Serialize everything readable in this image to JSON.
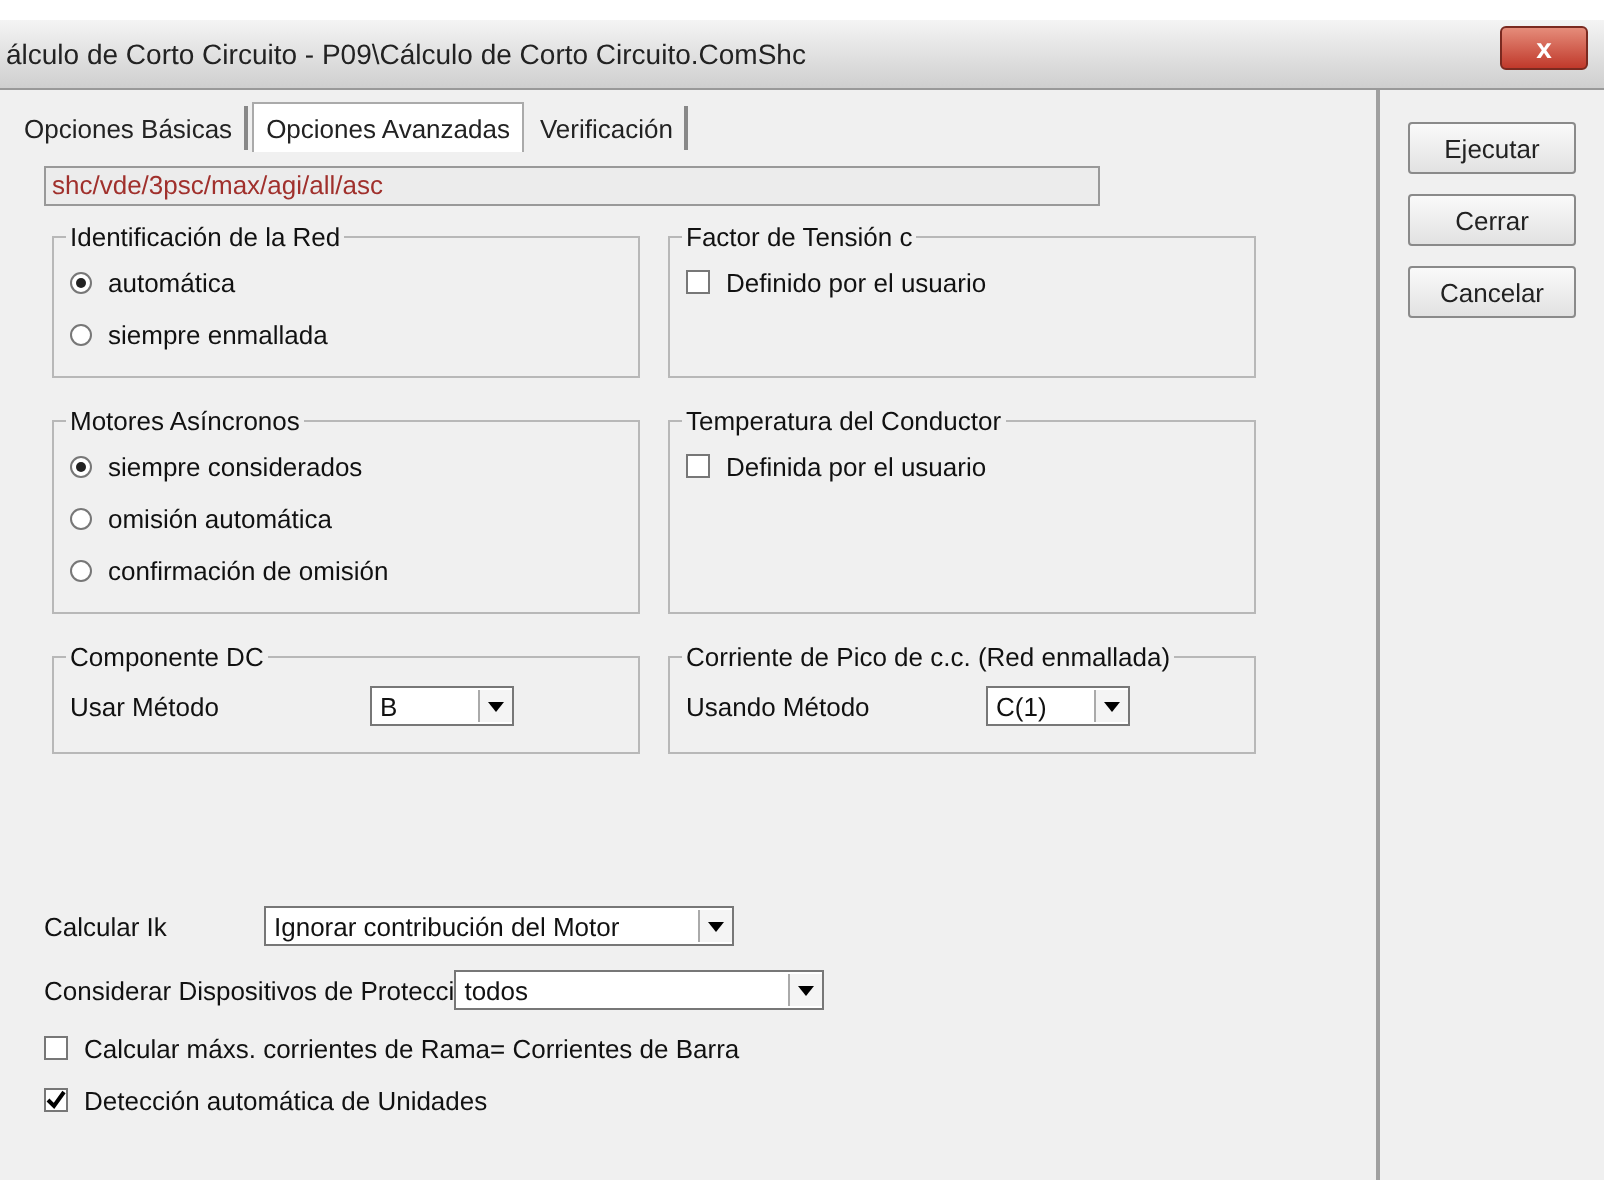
{
  "window": {
    "title": "álculo de Corto Circuito - P09\\Cálculo de Corto Circuito.ComShc",
    "close": "x"
  },
  "tabs": [
    {
      "label": "Opciones Básicas",
      "selected": false
    },
    {
      "label": "Opciones Avanzadas",
      "selected": true
    },
    {
      "label": "Verificación",
      "selected": false
    }
  ],
  "command": "shc/vde/3psc/max/agi/all/asc",
  "groups": [
    {
      "kind": "radio",
      "title": "Identificación de la Red",
      "items": [
        {
          "label": "automática",
          "selected": true
        },
        {
          "label": "siempre enmallada",
          "selected": false
        }
      ]
    },
    {
      "kind": "check",
      "title": "Factor de Tensión c",
      "items": [
        {
          "label": "Definido por el usuario",
          "checked": false
        }
      ]
    },
    {
      "kind": "radio",
      "title": "Motores Asíncronos",
      "items": [
        {
          "label": "siempre considerados",
          "selected": true
        },
        {
          "label": "omisión automática",
          "selected": false
        },
        {
          "label": "confirmación de omisión",
          "selected": false
        }
      ]
    },
    {
      "kind": "check",
      "title": "Temperatura del Conductor",
      "items": [
        {
          "label": "Definida por el usuario",
          "checked": false
        }
      ]
    },
    {
      "kind": "select",
      "title": "Componente DC",
      "label": "Usar Método",
      "value": "B"
    },
    {
      "kind": "select",
      "title": "Corriente de Pico de c.c. (Red enmallada)",
      "label": "Usando Método",
      "value": "C(1)"
    }
  ],
  "fields": [
    {
      "label": "Calcular Ik",
      "value": "Ignorar contribución del Motor"
    },
    {
      "label": "Considerar Dispositivos de Protecci",
      "value": "todos"
    }
  ],
  "checks": [
    {
      "label": "Calcular máxs. corrientes de Rama= Corrientes de Barra",
      "checked": false
    },
    {
      "label": "Detección automática de Unidades",
      "checked": true
    }
  ],
  "buttons": [
    "Ejecutar",
    "Cerrar",
    "Cancelar"
  ]
}
